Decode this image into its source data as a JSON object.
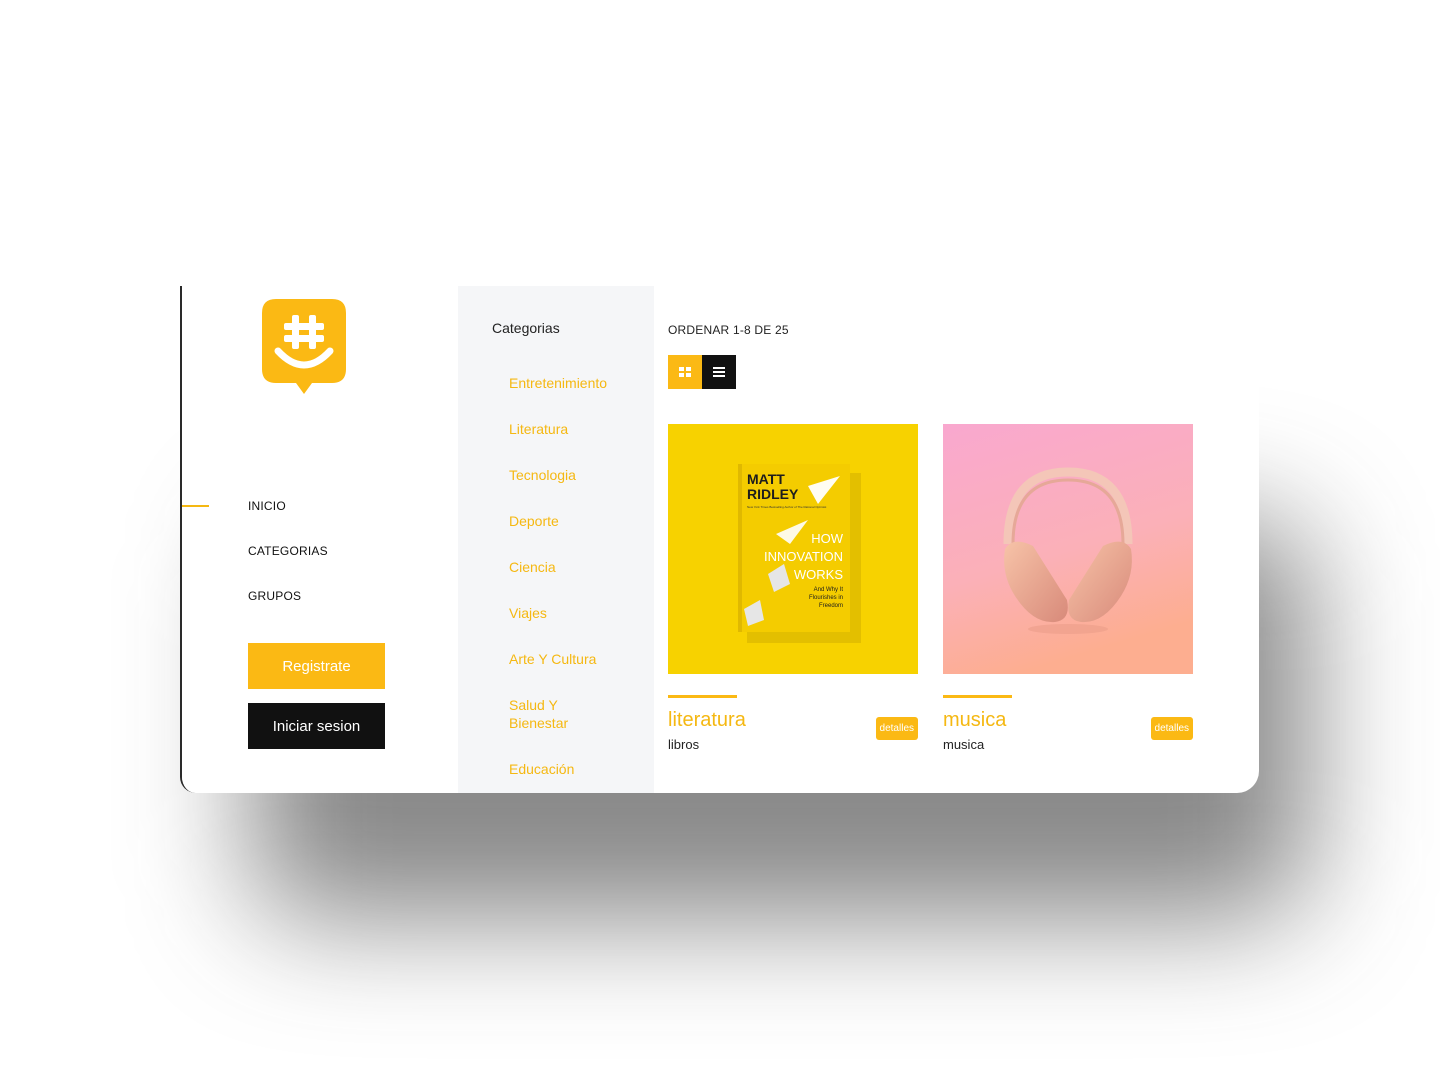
{
  "sidebar": {
    "nav": [
      {
        "label": "INICIO"
      },
      {
        "label": "CATEGORIAS"
      },
      {
        "label": "GRUPOS"
      }
    ],
    "register_label": "Registrate",
    "login_label": "Iniciar sesion"
  },
  "categories": {
    "title": "Categorias",
    "items": [
      "Entretenimiento",
      "Literatura",
      "Tecnologia",
      "Deporte",
      "Ciencia",
      "Viajes",
      "Arte Y Cultura",
      "Salud Y Bienestar",
      "Educación"
    ]
  },
  "main": {
    "sort_label": "ORDENAR 1-8 DE 25",
    "cards": [
      {
        "title": "literatura",
        "subtitle": "libros",
        "details_label": "detalles",
        "book": {
          "author_line1": "MATT",
          "author_line2": "RIDLEY",
          "tagline": "New York Times Bestselling Author of The Rational Optimist",
          "title_line1": "HOW",
          "title_line2": "INNOVATION",
          "title_line3": "WORKS",
          "subtitle_line1": "And Why It",
          "subtitle_line2": "Flourishes in",
          "subtitle_line3": "Freedom"
        }
      },
      {
        "title": "musica",
        "subtitle": "musica",
        "details_label": "detalles"
      }
    ]
  },
  "colors": {
    "accent": "#fbb914",
    "dark": "#111111",
    "panel": "#f5f6f8"
  },
  "icons": [
    "logo-chat-hashtag-icon",
    "grid-view-icon",
    "list-view-icon"
  ]
}
